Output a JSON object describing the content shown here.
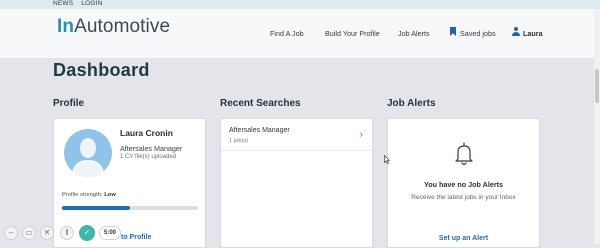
{
  "toplinks": {
    "news": "NEWS",
    "login": "LOGIN"
  },
  "logo": {
    "in": "In",
    "rest": "Automotive"
  },
  "nav": {
    "find_job": "Find A Job",
    "build_profile": "Build Your Profile",
    "job_alerts": "Job Alerts",
    "saved_jobs": "Saved jobs",
    "user": "Laura"
  },
  "page_title": "Dashboard",
  "profile": {
    "heading": "Profile",
    "name": "Laura Cronin",
    "title": "Aftersales Manager",
    "cv": "1 CV file(s) uploaded",
    "strength_label": "Profile strength:",
    "strength_value": "Low",
    "strength_fraction": 0.5,
    "link": "to Profile"
  },
  "recent_searches": {
    "heading": "Recent Searches",
    "items": [
      {
        "title": "Aftersales Manager",
        "count": "1 job(s)"
      }
    ]
  },
  "job_alerts": {
    "heading": "Job Alerts",
    "empty_title": "You have no Job Alerts",
    "empty_sub": "Receive the latest jobs in your Inbox",
    "cta": "Set up an Alert"
  },
  "recorder": {
    "timer": "5:00"
  },
  "colors": {
    "accent": "#2b6aa6",
    "brand": "#2f8fb0",
    "progress": "#1f6fb5",
    "record_green": "#3fb8a4"
  },
  "icons": [
    "bookmark-icon",
    "user-icon",
    "avatar-placeholder",
    "chevron-right-icon",
    "bell-icon",
    "mouse-cursor-icon",
    "minimize-icon",
    "screen-icon",
    "close-icon",
    "pause-icon",
    "check-icon"
  ]
}
